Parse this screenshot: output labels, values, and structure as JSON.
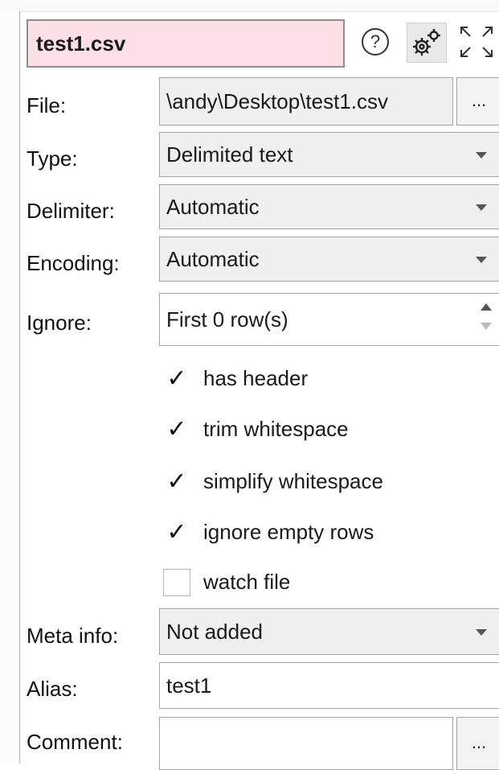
{
  "panel": {
    "title": "test1.csv",
    "title_bg": "#fde0e6",
    "icons": {
      "help": "question-circle-icon",
      "help_glyph": "?",
      "settings": "gears-icon",
      "expand": "expand-arrows-icon"
    }
  },
  "form": {
    "file": {
      "label": "File:",
      "value": "\\andy\\Desktop\\test1.csv",
      "browse_label": "..."
    },
    "type": {
      "label": "Type:",
      "value": "Delimited text"
    },
    "delimiter": {
      "label": "Delimiter:",
      "value": "Automatic"
    },
    "encoding": {
      "label": "Encoding:",
      "value": "Automatic"
    },
    "ignore": {
      "label": "Ignore:",
      "value": "First 0 row(s)"
    },
    "options": [
      {
        "label": "has header",
        "checked": true,
        "mark": "✓"
      },
      {
        "label": "trim whitespace",
        "checked": true,
        "mark": "✓"
      },
      {
        "label": "simplify whitespace",
        "checked": true,
        "mark": "✓"
      },
      {
        "label": "ignore empty rows",
        "checked": true,
        "mark": "✓"
      },
      {
        "label": "watch file",
        "checked": false,
        "mark": ""
      }
    ],
    "meta_info": {
      "label": "Meta info:",
      "value": "Not added"
    },
    "alias": {
      "label": "Alias:",
      "value": "test1"
    },
    "comment": {
      "label": "Comment:",
      "value": "",
      "browse_label": "..."
    }
  }
}
